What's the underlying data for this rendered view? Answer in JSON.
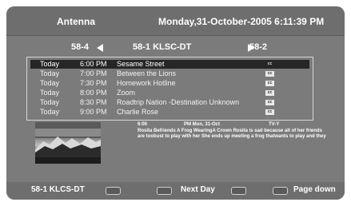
{
  "header": {
    "source": "Antenna",
    "datetime": "Monday,31-October-2005 6:11:39 PM"
  },
  "channel_nav": {
    "prev": "58-4",
    "current": "58-1  KLSC-DT",
    "next": "58-2"
  },
  "programs": [
    {
      "day": "Today",
      "time": "6:00 PM",
      "title": "Sesame Street",
      "cc": "cc",
      "selected": true
    },
    {
      "day": "Today",
      "time": "7:00 PM",
      "title": "Between the Lions",
      "cc": "cc",
      "selected": false
    },
    {
      "day": "Today",
      "time": "7:30 PM",
      "title": "Homework Hotline",
      "cc": "cc",
      "selected": false
    },
    {
      "day": "Today",
      "time": "8:00 PM",
      "title": "Zoom",
      "cc": "cc",
      "selected": false
    },
    {
      "day": "Today",
      "time": "8:30 PM",
      "title": "Roadtrip Nation -Destination Unknown",
      "cc": "cc",
      "selected": false
    },
    {
      "day": "Today",
      "time": "9:00 PM",
      "title": "Charlie Rose",
      "cc": "cc",
      "selected": false
    }
  ],
  "details": {
    "time": "6:00",
    "date": "PM  Mon, 31-Oct",
    "rating": "TV-Y",
    "description": "Rosita Befriends  A Frog WearingA Crown Rosita is sad because alt of her friends are toobust to play with her She ends up meeting a frog thatwants to play and they"
  },
  "footer": {
    "channel": "58-1 KLCS-DT",
    "next_day": "Next Day",
    "page_down": "Page down"
  }
}
